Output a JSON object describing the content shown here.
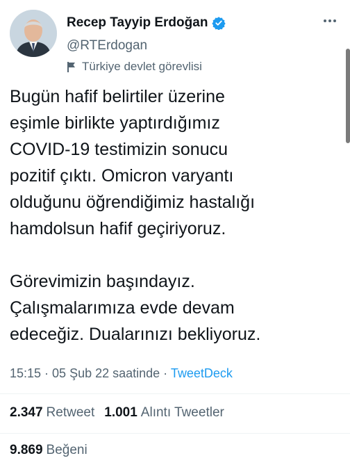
{
  "author": {
    "name": "Recep Tayyip Erdoğan",
    "handle": "@RTErdogan",
    "label": "Türkiye devlet görevlisi"
  },
  "tweet": {
    "text": "Bugün hafif belirtiler üzerine\neşimle birlikte yaptırdığımız\nCOVID-19 testimizin sonucu\npozitif çıktı. Omicron varyantı\nolduğunu öğrendiğimiz hastalığı\nhamdolsun hafif geçiriyoruz.\n\nGörevimizin başındayız.\nÇalışmalarımıza evde devam\nedeceğiz. Dualarınızı bekliyoruz.",
    "time": "15:15 · 05 Şub 22 saatinde · ",
    "source": "TweetDeck"
  },
  "stats": {
    "retweets_count": "2.347",
    "retweets_label": "Retweet",
    "quotes_count": "1.001",
    "quotes_label": "Alıntı Tweetler",
    "likes_count": "9.869",
    "likes_label": "Beğeni"
  },
  "colors": {
    "accent": "#1d9bf0",
    "secondary": "#536471",
    "text": "#0f1419"
  }
}
